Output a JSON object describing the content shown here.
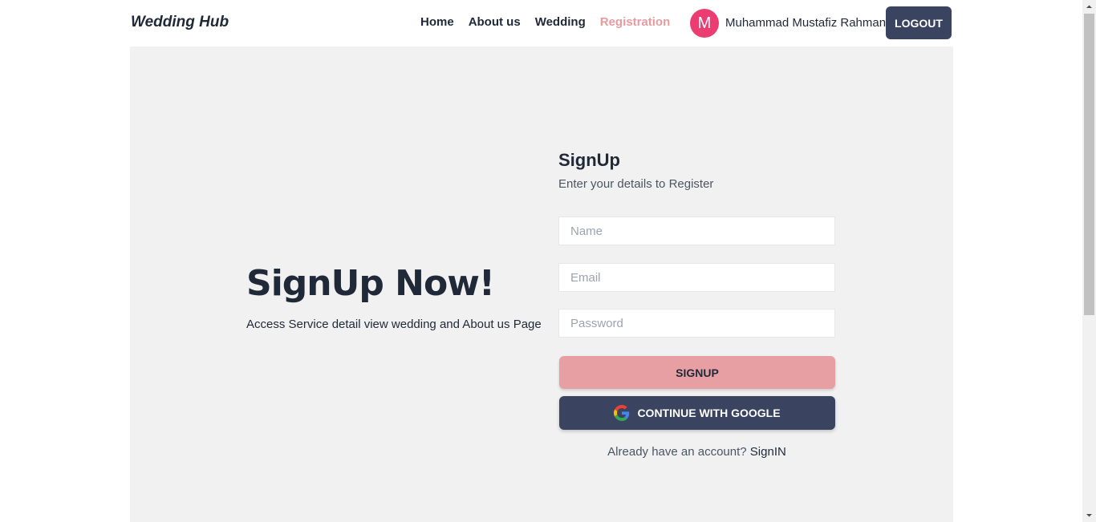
{
  "navbar": {
    "brand": "Wedding Hub",
    "links": [
      {
        "label": "Home",
        "active": false
      },
      {
        "label": "About us",
        "active": false
      },
      {
        "label": "Wedding",
        "active": false
      },
      {
        "label": "Registration",
        "active": true
      }
    ],
    "avatar_initial": "M",
    "user_name": "Muhammad Mustafiz Rahman",
    "logout_label": "LOGOUT"
  },
  "hero": {
    "title": "SignUp Now!",
    "subtitle": "Access Service detail view wedding and About us Page"
  },
  "form": {
    "title": "SignUp",
    "subtitle": "Enter your details to Register",
    "name_placeholder": "Name",
    "email_placeholder": "Email",
    "password_placeholder": "Password",
    "signup_label": "SIGNUP",
    "google_label": "CONTINUE WITH GOOGLE",
    "signin_prompt": "Already have an account?",
    "signin_link": "SignIN"
  },
  "colors": {
    "accent_pink": "#e89fa4",
    "dark_navy": "#3a4360",
    "avatar_pink": "#ec3d72",
    "panel_bg": "#f1f1f1"
  },
  "icons": {
    "google": "google-logo-icon",
    "scroll_up": "chevron-up-icon",
    "scroll_down": "chevron-down-icon"
  }
}
